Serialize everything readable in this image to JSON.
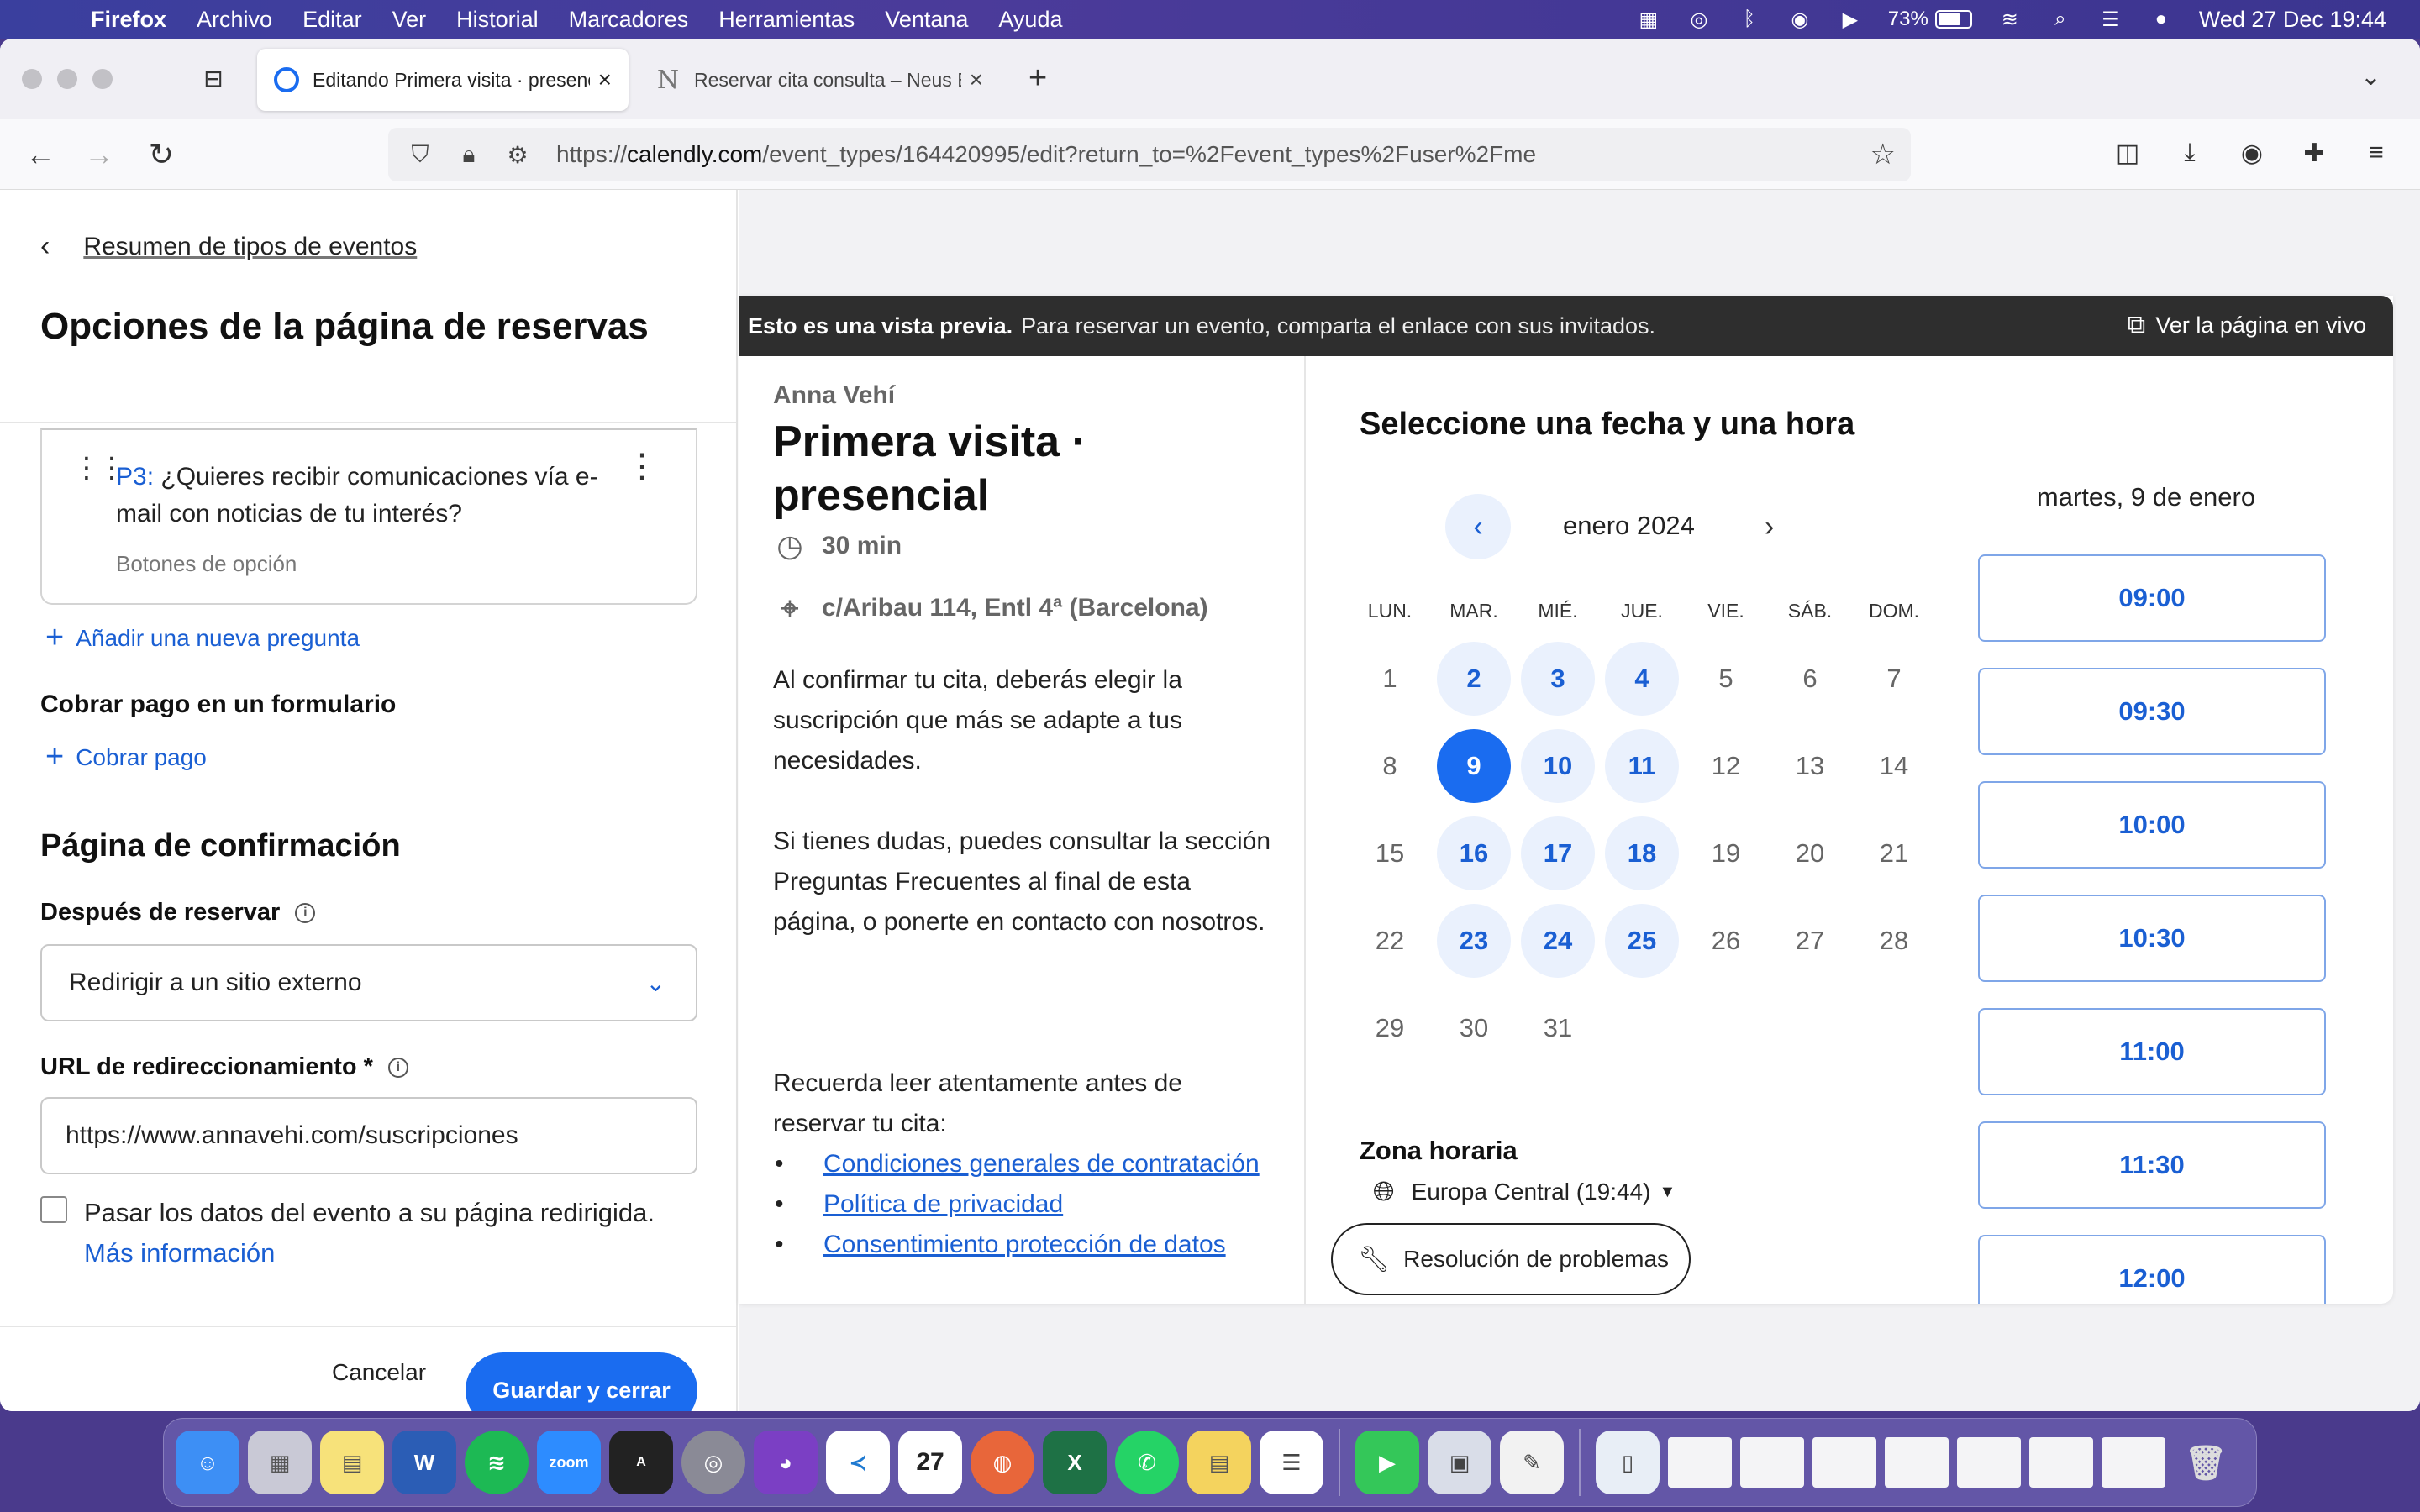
{
  "menubar": {
    "app_name": "Firefox",
    "menus": [
      "Archivo",
      "Editar",
      "Ver",
      "Historial",
      "Marcadores",
      "Herramientas",
      "Ventana",
      "Ayuda"
    ],
    "battery_percent": "73%",
    "battery_level": 0.73,
    "datetime": "Wed 27 Dec  19:44"
  },
  "browser": {
    "tabs": [
      {
        "title": "Editando Primera visita · presencial",
        "active": true
      },
      {
        "title": "Reservar cita consulta – Neus El",
        "active": false
      }
    ],
    "url_prefix": "https://",
    "url_domain": "calendly.com",
    "url_path": "/event_types/164420995/edit?return_to=%2Fevent_types%2Fuser%2Fme"
  },
  "editor": {
    "back_link": "Resumen de tipos de eventos",
    "title": "Opciones de la página de reservas",
    "question": {
      "number": "P3:",
      "text": "¿Quieres recibir comunicaciones vía e-mail con noticias de tu interés?",
      "type": "Botones de opción"
    },
    "add_question": "Añadir una nueva pregunta",
    "payment_heading": "Cobrar pago en un formulario",
    "payment_link": "Cobrar pago",
    "confirmation_heading": "Página de confirmación",
    "after_booking_label": "Después de reservar",
    "after_booking_value": "Redirigir a un sitio externo",
    "redirect_label": "URL de redireccionamiento *",
    "redirect_value": "https://www.annavehi.com/suscripciones",
    "pass_data_label": "Pasar los datos del evento a su página redirigida.",
    "more_info": "Más información",
    "cancel": "Cancelar",
    "save": "Guardar y cerrar"
  },
  "preview": {
    "banner_bold": "Esto es una vista previa.",
    "banner_text": "Para reservar un evento, comparta el enlace con sus invitados.",
    "live_link": "Ver la página en vivo",
    "host": "Anna Vehí",
    "event_title": "Primera visita · presencial",
    "duration": "30 min",
    "location": "c/Aribau 114, Entl 4ª (Barcelona)",
    "desc1": "Al confirmar tu cita, deberás elegir la suscripción que más se adapte a tus necesidades.",
    "desc2": "Si tienes dudas, puedes consultar la sección Preguntas Frecuentes al final de esta página, o ponerte en contacto con nosotros.",
    "desc3": "Recuerda leer atentamente antes de reservar tu cita:",
    "links": [
      "Condiciones generales de contratación",
      "Política de privacidad",
      "Consentimiento protección de datos"
    ],
    "calendar_heading": "Seleccione una fecha y una hora",
    "month": "enero 2024",
    "weekdays": [
      "LUN.",
      "MAR.",
      "MIÉ.",
      "JUE.",
      "VIE.",
      "SÁB.",
      "DOM."
    ],
    "days": [
      {
        "n": "1",
        "s": "none"
      },
      {
        "n": "2",
        "s": "available"
      },
      {
        "n": "3",
        "s": "available"
      },
      {
        "n": "4",
        "s": "available"
      },
      {
        "n": "5",
        "s": "none"
      },
      {
        "n": "6",
        "s": "none"
      },
      {
        "n": "7",
        "s": "none"
      },
      {
        "n": "8",
        "s": "none"
      },
      {
        "n": "9",
        "s": "selected"
      },
      {
        "n": "10",
        "s": "available"
      },
      {
        "n": "11",
        "s": "available"
      },
      {
        "n": "12",
        "s": "none"
      },
      {
        "n": "13",
        "s": "none"
      },
      {
        "n": "14",
        "s": "none"
      },
      {
        "n": "15",
        "s": "none"
      },
      {
        "n": "16",
        "s": "available"
      },
      {
        "n": "17",
        "s": "available"
      },
      {
        "n": "18",
        "s": "available"
      },
      {
        "n": "19",
        "s": "none"
      },
      {
        "n": "20",
        "s": "none"
      },
      {
        "n": "21",
        "s": "none"
      },
      {
        "n": "22",
        "s": "none"
      },
      {
        "n": "23",
        "s": "available"
      },
      {
        "n": "24",
        "s": "available"
      },
      {
        "n": "25",
        "s": "available"
      },
      {
        "n": "26",
        "s": "none"
      },
      {
        "n": "27",
        "s": "none"
      },
      {
        "n": "28",
        "s": "none"
      },
      {
        "n": "29",
        "s": "none"
      },
      {
        "n": "30",
        "s": "none"
      },
      {
        "n": "31",
        "s": "none"
      }
    ],
    "timezone_label": "Zona horaria",
    "timezone_value": "Europa Central (19:44)",
    "troubleshoot": "Resolución de problemas",
    "selected_date": "martes, 9 de enero",
    "slots": [
      "09:00",
      "09:30",
      "10:00",
      "10:30",
      "11:00",
      "11:30",
      "12:00"
    ]
  },
  "colors": {
    "primary": "#1a6cf0",
    "link": "#1a5fd3",
    "available_day_bg": "#eaf1fd"
  }
}
